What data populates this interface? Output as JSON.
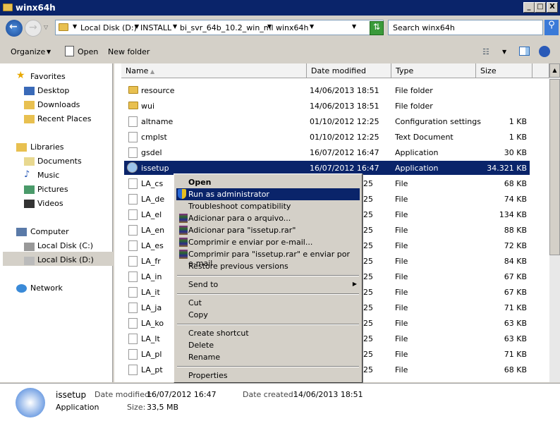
{
  "window": {
    "title": "winx64h",
    "minimize": "_",
    "maximize": "□",
    "close": "X"
  },
  "address": {
    "crumbs": [
      "Local Disk (D:)",
      "INSTALL",
      "bi_svr_64b_10.2_win_ml",
      "winx64h"
    ],
    "search_placeholder": "Search winx64h"
  },
  "toolbar": {
    "organize": "Organize",
    "open": "Open",
    "new_folder": "New folder"
  },
  "nav": {
    "items": [
      {
        "label": "Favorites",
        "icon": "star-icon"
      },
      {
        "label": "Desktop",
        "icon": "desktop-icon"
      },
      {
        "label": "Downloads",
        "icon": "downloads-icon"
      },
      {
        "label": "Recent Places",
        "icon": "recent-places-icon"
      },
      {
        "label": "Libraries",
        "icon": "libraries-icon"
      },
      {
        "label": "Documents",
        "icon": "documents-icon"
      },
      {
        "label": "Music",
        "icon": "music-icon"
      },
      {
        "label": "Pictures",
        "icon": "pictures-icon"
      },
      {
        "label": "Videos",
        "icon": "videos-icon"
      },
      {
        "label": "Computer",
        "icon": "computer-icon"
      },
      {
        "label": "Local Disk (C:)",
        "icon": "drive-icon"
      },
      {
        "label": "Local Disk (D:)",
        "icon": "drive-icon"
      },
      {
        "label": "Network",
        "icon": "network-icon"
      }
    ]
  },
  "columns": [
    "Name",
    "Date modified",
    "Type",
    "Size"
  ],
  "files": [
    {
      "name": "resource",
      "date": "14/06/2013 18:51",
      "type": "File folder",
      "size": ""
    },
    {
      "name": "wui",
      "date": "14/06/2013 18:51",
      "type": "File folder",
      "size": ""
    },
    {
      "name": "altname",
      "date": "01/10/2012 12:25",
      "type": "Configuration settings",
      "size": "1 KB"
    },
    {
      "name": "cmplst",
      "date": "01/10/2012 12:25",
      "type": "Text Document",
      "size": "1 KB"
    },
    {
      "name": "gsdel",
      "date": "16/07/2012 16:47",
      "type": "Application",
      "size": "30 KB"
    },
    {
      "name": "issetup",
      "date": "16/07/2012 16:47",
      "type": "Application",
      "size": "34.321 KB",
      "selected": true
    },
    {
      "name": "LA_cs",
      "date": "25",
      "type": "File",
      "size": "68 KB"
    },
    {
      "name": "LA_de",
      "date": "25",
      "type": "File",
      "size": "74 KB"
    },
    {
      "name": "LA_el",
      "date": "25",
      "type": "File",
      "size": "134 KB"
    },
    {
      "name": "LA_en",
      "date": "25",
      "type": "File",
      "size": "88 KB"
    },
    {
      "name": "LA_es",
      "date": "25",
      "type": "File",
      "size": "72 KB"
    },
    {
      "name": "LA_fr",
      "date": "25",
      "type": "File",
      "size": "84 KB"
    },
    {
      "name": "LA_in",
      "date": "25",
      "type": "File",
      "size": "67 KB"
    },
    {
      "name": "LA_it",
      "date": "25",
      "type": "File",
      "size": "67 KB"
    },
    {
      "name": "LA_ja",
      "date": "25",
      "type": "File",
      "size": "71 KB"
    },
    {
      "name": "LA_ko",
      "date": "25",
      "type": "File",
      "size": "63 KB"
    },
    {
      "name": "LA_lt",
      "date": "25",
      "type": "File",
      "size": "63 KB"
    },
    {
      "name": "LA_pl",
      "date": "25",
      "type": "File",
      "size": "71 KB"
    },
    {
      "name": "LA_pt",
      "date": "25",
      "type": "File",
      "size": "68 KB"
    }
  ],
  "context_menu": [
    "Open",
    "Run as administrator",
    "Troubleshoot compatibility",
    "Adicionar para o arquivo...",
    "Adicionar para \"issetup.rar\"",
    "Comprimir e enviar por e-mail...",
    "Comprimir para \"issetup.rar\" e enviar por e-mail",
    "Restore previous versions",
    "Send to",
    "Cut",
    "Copy",
    "Create shortcut",
    "Delete",
    "Rename",
    "Properties"
  ],
  "details": {
    "name": "issetup",
    "type": "Application",
    "modified_label": "Date modified:",
    "modified": "16/07/2012 16:47",
    "created_label": "Date created:",
    "created": "14/06/2013 18:51",
    "size_label": "Size:",
    "size": "33,5 MB"
  }
}
